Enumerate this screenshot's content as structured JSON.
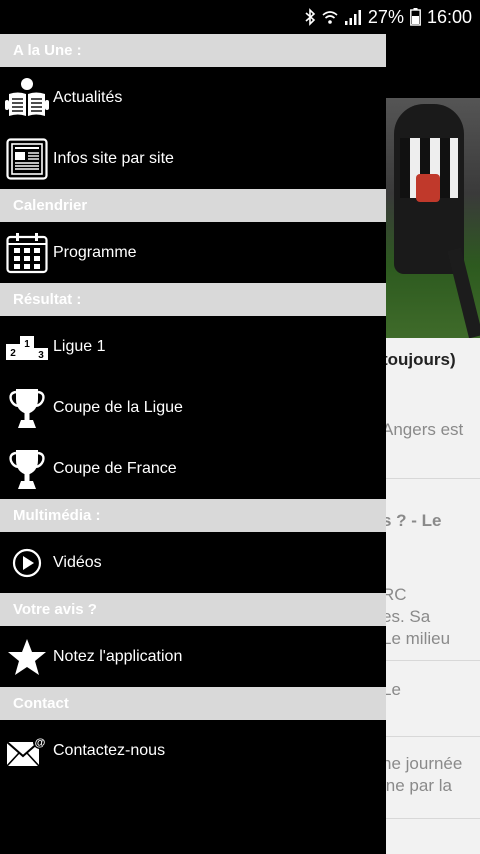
{
  "status_bar": {
    "battery": "27%",
    "time": "16:00"
  },
  "background": {
    "lines": [
      {
        "text": "toujours)",
        "bold": true
      },
      {
        "text": "Angers est",
        "bold": false
      },
      {
        "text": "s ? - Le",
        "bold": true
      },
      {
        "text": "RC",
        "bold": false
      },
      {
        "text": "es. Sa",
        "bold": false
      },
      {
        "text": "Le milieu",
        "bold": false
      },
      {
        "text": "Le",
        "bold": false
      },
      {
        "text": "ne journée",
        "bold": false
      },
      {
        "text": "ine par la",
        "bold": false
      }
    ]
  },
  "drawer": {
    "sections": [
      {
        "header": "A la Une :",
        "items": [
          {
            "label": "Actualités",
            "icon": "newspaper-reader-icon"
          },
          {
            "label": "Infos site par site",
            "icon": "newspaper-icon"
          }
        ]
      },
      {
        "header": "Calendrier",
        "items": [
          {
            "label": "Programme",
            "icon": "calendar-icon"
          }
        ]
      },
      {
        "header": "Résultat :",
        "items": [
          {
            "label": "Ligue 1",
            "icon": "podium-icon"
          },
          {
            "label": "Coupe de la Ligue",
            "icon": "trophy-icon"
          },
          {
            "label": "Coupe de France",
            "icon": "trophy-icon"
          }
        ]
      },
      {
        "header": "Multimédia :",
        "items": [
          {
            "label": "Vidéos",
            "icon": "play-icon"
          }
        ]
      },
      {
        "header": "Votre avis ?",
        "items": [
          {
            "label": "Notez l'application",
            "icon": "star-icon"
          }
        ]
      },
      {
        "header": "Contact",
        "items": [
          {
            "label": "Contactez-nous",
            "icon": "mail-icon"
          }
        ]
      }
    ]
  }
}
